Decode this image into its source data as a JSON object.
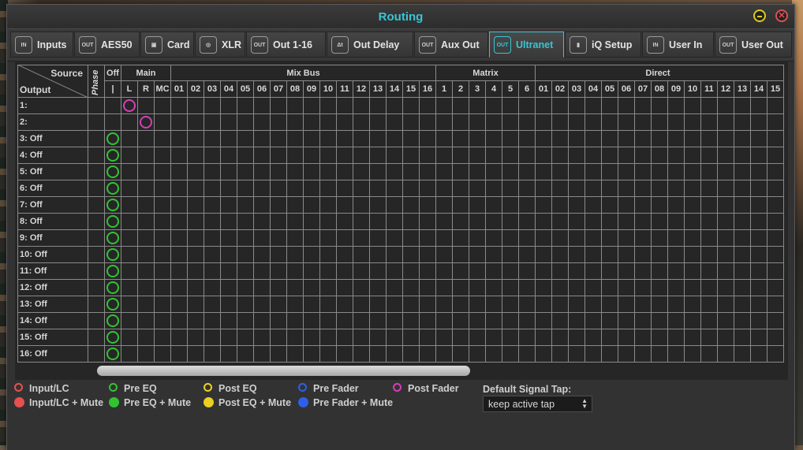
{
  "window": {
    "title": "Routing"
  },
  "tabs": [
    {
      "label": "Inputs",
      "icon": "in-icon",
      "badge": "IN",
      "active": false
    },
    {
      "label": "AES50",
      "icon": "out-icon",
      "badge": "OUT",
      "active": false
    },
    {
      "label": "Card",
      "icon": "card-icon",
      "badge": "▣",
      "active": false
    },
    {
      "label": "XLR",
      "icon": "xlr-icon",
      "badge": "◎",
      "active": false
    },
    {
      "label": "Out 1-16",
      "icon": "out-icon",
      "badge": "OUT",
      "active": false
    },
    {
      "label": "Out Delay",
      "icon": "delay-icon",
      "badge": "Δt",
      "active": false
    },
    {
      "label": "Aux Out",
      "icon": "out-icon",
      "badge": "OUT",
      "active": false
    },
    {
      "label": "Ultranet",
      "icon": "out-icon",
      "badge": "OUT",
      "active": true
    },
    {
      "label": "iQ Setup",
      "icon": "speaker-icon",
      "badge": "▮",
      "active": false
    },
    {
      "label": "User In",
      "icon": "in-icon",
      "badge": "IN",
      "active": false
    },
    {
      "label": "User Out",
      "icon": "out-icon",
      "badge": "OUT",
      "active": false
    }
  ],
  "grid": {
    "corner_source": "Source",
    "corner_output": "Output",
    "phase_label": "Phase",
    "off_label": "Off",
    "off_sub": "|",
    "groups": {
      "main": "Main",
      "mixbus": "Mix Bus",
      "matrix": "Matrix",
      "direct": "Direct"
    },
    "main_cols": [
      "L",
      "R",
      "MC"
    ],
    "mixbus_cols": [
      "01",
      "02",
      "03",
      "04",
      "05",
      "06",
      "07",
      "08",
      "09",
      "10",
      "11",
      "12",
      "13",
      "14",
      "15",
      "16"
    ],
    "matrix_cols": [
      "1",
      "2",
      "3",
      "4",
      "5",
      "6"
    ],
    "direct_cols": [
      "01",
      "02",
      "03",
      "04",
      "05",
      "06",
      "07",
      "08",
      "09",
      "10",
      "11",
      "12",
      "13",
      "14",
      "15"
    ],
    "rows": [
      "1:",
      "2:",
      "3: Off",
      "4: Off",
      "5: Off",
      "6: Off",
      "7: Off",
      "8: Off",
      "9: Off",
      "10: Off",
      "11: Off",
      "12: Off",
      "13: Off",
      "14: Off",
      "15: Off",
      "16: Off"
    ],
    "assignments": [
      {
        "row": 0,
        "col": "L",
        "tap": "post_fader"
      },
      {
        "row": 1,
        "col": "R",
        "tap": "post_fader"
      },
      {
        "row": 2,
        "col": "Off",
        "tap": "pre_eq"
      },
      {
        "row": 3,
        "col": "Off",
        "tap": "pre_eq"
      },
      {
        "row": 4,
        "col": "Off",
        "tap": "pre_eq"
      },
      {
        "row": 5,
        "col": "Off",
        "tap": "pre_eq"
      },
      {
        "row": 6,
        "col": "Off",
        "tap": "pre_eq"
      },
      {
        "row": 7,
        "col": "Off",
        "tap": "pre_eq"
      },
      {
        "row": 8,
        "col": "Off",
        "tap": "pre_eq"
      },
      {
        "row": 9,
        "col": "Off",
        "tap": "pre_eq"
      },
      {
        "row": 10,
        "col": "Off",
        "tap": "pre_eq"
      },
      {
        "row": 11,
        "col": "Off",
        "tap": "pre_eq"
      },
      {
        "row": 12,
        "col": "Off",
        "tap": "pre_eq"
      },
      {
        "row": 13,
        "col": "Off",
        "tap": "pre_eq"
      },
      {
        "row": 14,
        "col": "Off",
        "tap": "pre_eq"
      },
      {
        "row": 15,
        "col": "Off",
        "tap": "pre_eq"
      }
    ]
  },
  "legend": {
    "input_lc": "Input/LC",
    "input_lc_mute": "Input/LC + Mute",
    "pre_eq": "Pre EQ",
    "pre_eq_mute": "Pre EQ + Mute",
    "post_eq": "Post EQ",
    "post_eq_mute": "Post EQ + Mute",
    "pre_fader": "Pre Fader",
    "pre_fader_mute": "Pre Fader + Mute",
    "post_fader": "Post Fader"
  },
  "colors": {
    "accent": "#37c6d4",
    "input_lc": "#e85050",
    "pre_eq": "#31c431",
    "post_eq": "#ecd020",
    "pre_fader": "#2f5fe8",
    "post_fader": "#d63fb6"
  },
  "signal_tap": {
    "label": "Default Signal Tap:",
    "value": "keep active tap"
  }
}
